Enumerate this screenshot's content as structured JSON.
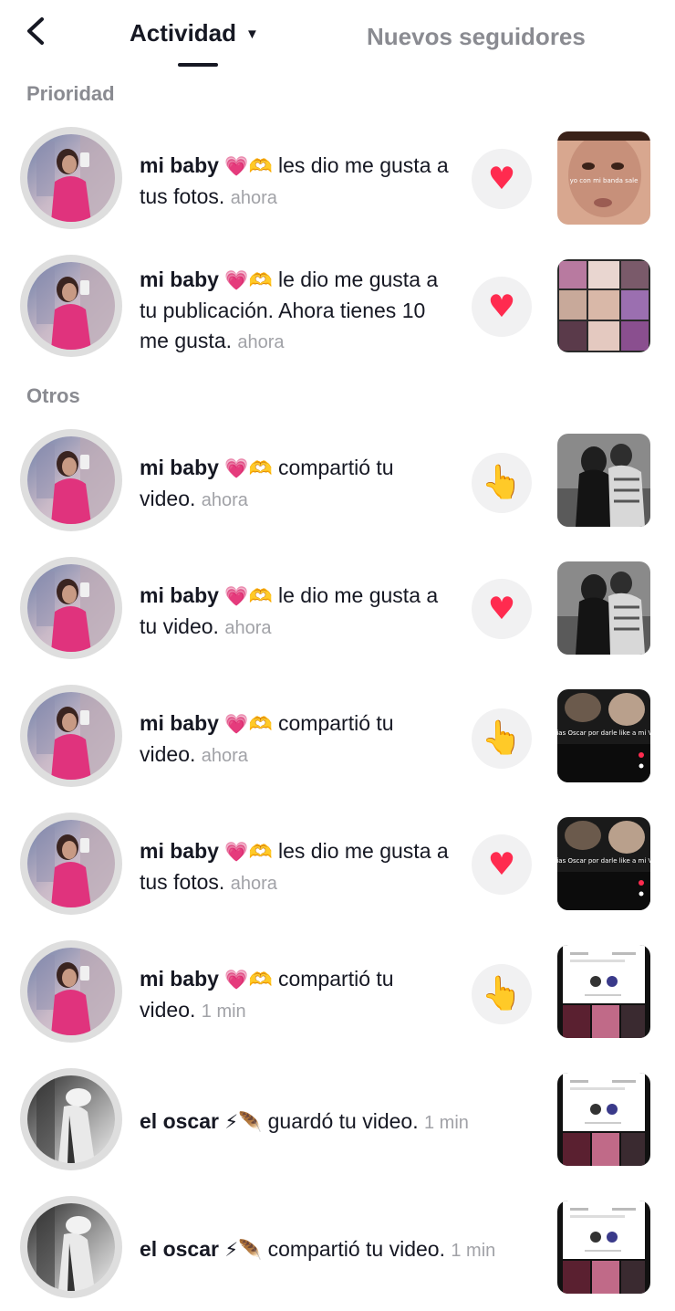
{
  "header": {
    "back_icon": "chevron-left-icon",
    "tab_activity": "Actividad",
    "dropdown_icon": "caret-down-icon",
    "tab_followers": "Nuevos seguidores"
  },
  "sections": {
    "priority": "Prioridad",
    "others": "Otros"
  },
  "notifications": [
    {
      "name": "mi baby",
      "emoji": "💗🫶",
      "action": "les dio me gusta a tus fotos.",
      "time": "ahora",
      "reaction_icon": "heart-icon",
      "thumb_caption": "yo con mi banda sale"
    },
    {
      "name": "mi baby",
      "emoji": "💗🫶",
      "action": "le dio me gusta a tu publicación. Ahora tienes 10 me gusta.",
      "time": "ahora",
      "reaction_icon": "heart-icon",
      "thumb_caption": ""
    },
    {
      "name": "mi baby",
      "emoji": "💗🫶",
      "action": "compartió tu video.",
      "time": "ahora",
      "reaction_icon": "pointing-hand-icon",
      "thumb_caption": ""
    },
    {
      "name": "mi baby",
      "emoji": "💗🫶",
      "action": "le dio me gusta a tu video.",
      "time": "ahora",
      "reaction_icon": "heart-icon",
      "thumb_caption": ""
    },
    {
      "name": "mi baby",
      "emoji": "💗🫶",
      "action": "compartió tu video.",
      "time": "ahora",
      "reaction_icon": "pointing-hand-icon",
      "thumb_caption": "Gracias Oscar por darle like a mi Video"
    },
    {
      "name": "mi baby",
      "emoji": "💗🫶",
      "action": "les dio me gusta a tus fotos.",
      "time": "ahora",
      "reaction_icon": "heart-icon",
      "thumb_caption": "Gracias Oscar por darle like a mi Video"
    },
    {
      "name": "mi baby",
      "emoji": "💗🫶",
      "action": "compartió tu video.",
      "time": "1 min",
      "reaction_icon": "pointing-hand-icon",
      "thumb_caption": ""
    },
    {
      "name": "el oscar",
      "emoji": "⚡🪶",
      "action": "guardó tu video.",
      "time": "1 min",
      "reaction_icon": "",
      "thumb_caption": ""
    },
    {
      "name": "el oscar",
      "emoji": "⚡🪶",
      "action": "compartió tu video.",
      "time": "1 min",
      "reaction_icon": "",
      "thumb_caption": ""
    }
  ],
  "colors": {
    "heart": "#ff2b4f",
    "secondary_text": "#8a8b91",
    "button_bg": "#f1f1f2"
  }
}
